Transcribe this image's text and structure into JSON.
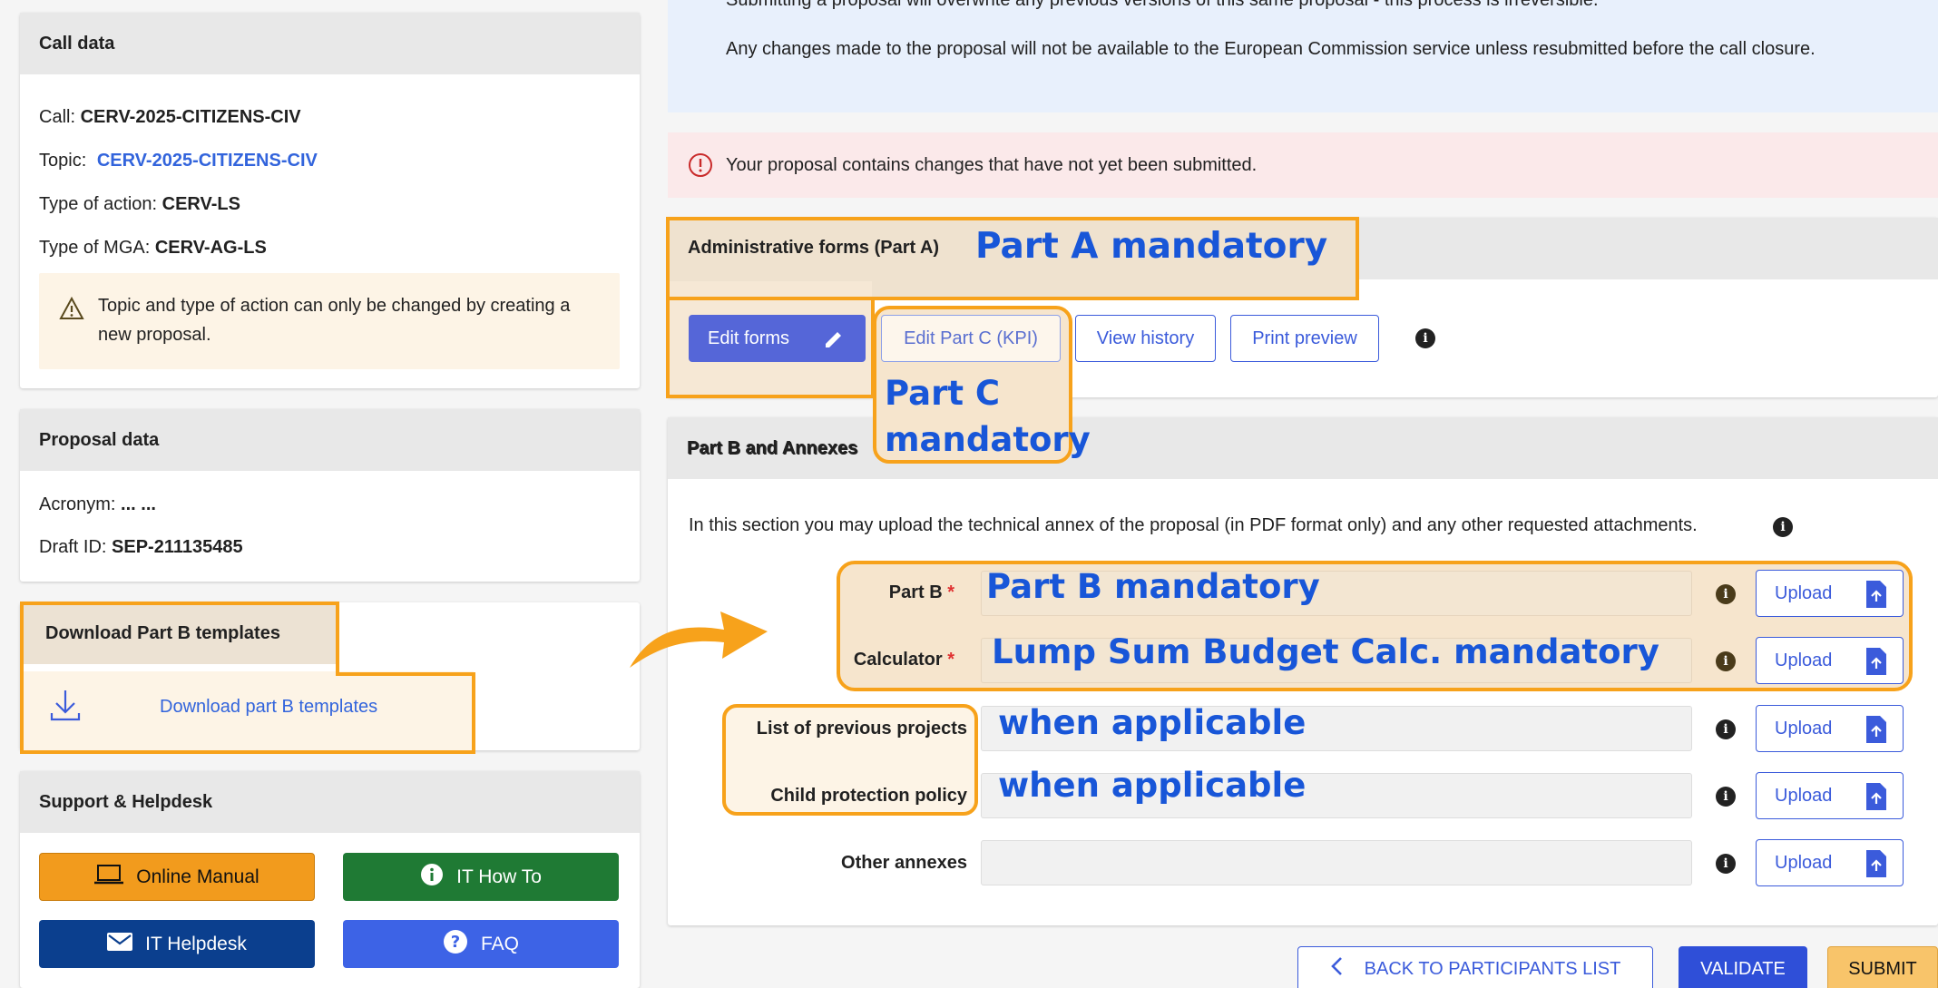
{
  "call_data": {
    "title": "Call data",
    "call_label": "Call:",
    "call_value": "CERV-2025-CITIZENS-CIV",
    "topic_label": "Topic:",
    "topic_value": "CERV-2025-CITIZENS-CIV",
    "action_label": "Type of action:",
    "action_value": "CERV-LS",
    "mga_label": "Type of MGA:",
    "mga_value": "CERV-AG-LS",
    "warning": "Topic and type of action can only be changed by creating a new proposal."
  },
  "proposal_data": {
    "title": "Proposal data",
    "acronym_label": "Acronym:",
    "acronym_value": "... ...",
    "draft_label": "Draft ID:",
    "draft_value": "SEP-211135485"
  },
  "download": {
    "title": "Download Part B templates",
    "link": "Download part B templates"
  },
  "support": {
    "title": "Support & Helpdesk",
    "manual": "Online Manual",
    "howto": "IT How To",
    "helpdesk": "IT Helpdesk",
    "faq": "FAQ"
  },
  "notice": {
    "line1": "Submitting a proposal will overwrite any previous versions of this same proposal - this process is irreversible.",
    "line2": "Any changes made to the proposal will not be available to the European Commission service unless resubmitted before the call closure."
  },
  "alert": "Your proposal contains changes that have not yet been submitted.",
  "admin": {
    "title": "Administrative forms (Part A)",
    "edit_forms": "Edit forms",
    "edit_part_c": "Edit Part C (KPI)",
    "view_history": "View history",
    "print_preview": "Print preview"
  },
  "partb": {
    "title": "Part B and Annexes",
    "description": "In this section you may upload the technical annex of the proposal (in PDF format only) and any other requested attachments.",
    "upload_label": "Upload",
    "fields": [
      {
        "label": "Part B",
        "required": true
      },
      {
        "label": "Calculator",
        "required": true
      },
      {
        "label": "List of previous projects",
        "required": false
      },
      {
        "label": "Child protection policy",
        "required": false
      },
      {
        "label": "Other annexes",
        "required": false
      }
    ]
  },
  "footer": {
    "back": "BACK TO PARTICIPANTS LIST",
    "validate": "VALIDATE",
    "submit": "SUBMIT"
  },
  "annotations": {
    "part_a": "Part A mandatory",
    "part_c_line1": "Part C",
    "part_c_line2": "mandatory",
    "part_b": "Part B mandatory",
    "calculator": "Lump Sum Budget Calc. mandatory",
    "prev_projects": "when applicable",
    "child_policy": "when applicable"
  },
  "colors": {
    "annotation_border": "#f7a21b",
    "annotation_text": "#1856d8",
    "primary": "#3b5bdb",
    "manual_btn": "#f29b1d",
    "howto_btn": "#1f7a34",
    "helpdesk_btn": "#0b3f8e",
    "faq_btn": "#3d63e6"
  }
}
